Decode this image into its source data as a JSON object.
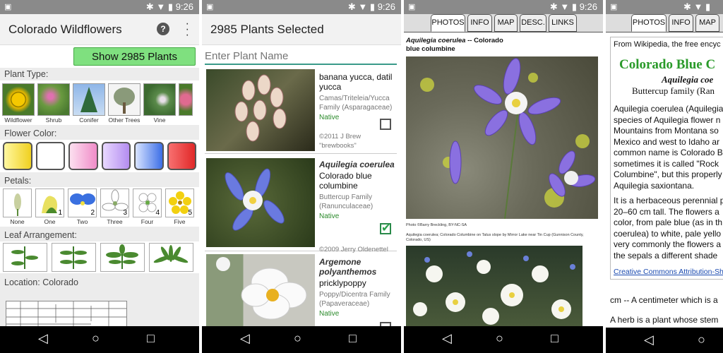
{
  "status": {
    "time": "9:26"
  },
  "p1": {
    "title": "Colorado Wildflowers",
    "show_button": "Show 2985 Plants",
    "plant_type_label": "Plant Type:",
    "plant_types": [
      "Wildflower",
      "Shrub",
      "Conifer",
      "Other Trees",
      "Vine"
    ],
    "flower_color_label": "Flower Color:",
    "flower_colors": [
      "#f0d020",
      "#ffffff",
      "#f08cc8",
      "#b48cf0",
      "#3c6ee6",
      "#e02828"
    ],
    "petals_label": "Petals:",
    "petals": [
      {
        "label": "None",
        "num": ""
      },
      {
        "label": "One",
        "num": "1"
      },
      {
        "label": "Two",
        "num": "2"
      },
      {
        "label": "Three",
        "num": "3"
      },
      {
        "label": "Four",
        "num": "4"
      },
      {
        "label": "Five",
        "num": "5"
      }
    ],
    "leaf_label": "Leaf Arrangement:",
    "location_label": "Location: Colorado"
  },
  "p2": {
    "title": "2985 Plants Selected",
    "search_placeholder": "Enter Plant Name",
    "plants": [
      {
        "latin": "",
        "common": "banana yucca, datil yucca",
        "family": "Camas/Triteleia/Yucca Family (Asparagaceae)",
        "native": "Native",
        "credit": "©2011 J Brew \"brewbooks\"",
        "checked": false
      },
      {
        "latin": "Aquilegia coerulea",
        "common": "Colorado blue columbine",
        "family": "Buttercup Family (Ranunculaceae)",
        "native": "Native",
        "credit": "©2009 Jerry Oldenettel",
        "checked": true
      },
      {
        "latin": "Argemone polyanthemos",
        "common": "pricklypoppy",
        "family": "Poppy/Dicentra Family (Papaveraceae)",
        "native": "Native",
        "credit": "",
        "checked": false
      }
    ]
  },
  "p3": {
    "tabs": [
      "PHOTOS",
      "INFO",
      "MAP",
      "DESC.",
      "LINKS"
    ],
    "heading_latin": "Aquilegia coerulea",
    "heading_rest": " -- Colorado blue columbine",
    "photo_credit": "Photo ©Barry Breckling, BY-NC-SA",
    "photo_caption": "Aquilegia coerulea; Colorado Columbine on Talus slope by Mirror Lake near Tin Cup (Gunnison County, Colorado, US)"
  },
  "p4": {
    "tabs": [
      "PHOTOS",
      "INFO",
      "MAP"
    ],
    "source": "From Wikipedia, the free encyc",
    "wiki_title": "Colorado Blue C",
    "wiki_latin": "Aquilegia coe",
    "wiki_family": "Buttercup family (Ran",
    "para1": [
      "Aquilegia coerulea (Aquilegia",
      "species of Aquilegia flower n",
      "Mountains from Montana so",
      "Mexico and west to Idaho ar",
      "common name is Colorado B",
      "sometimes it is called \"Rock",
      "Columbine\", but this properly",
      "Aquilegia saxiontana."
    ],
    "para2": [
      "It is a herbaceous perennial p",
      "20–60 cm tall. The flowers a",
      "color, from pale blue (as in th",
      "coerulea) to white, pale yello",
      "very commonly the flowers a",
      "the sepals a different shade"
    ],
    "cc_link": "Creative Commons Attribution-Sha",
    "gloss_cm": "cm -- A centimeter which is a",
    "gloss_herb": "A herb is a plant whose stem"
  }
}
